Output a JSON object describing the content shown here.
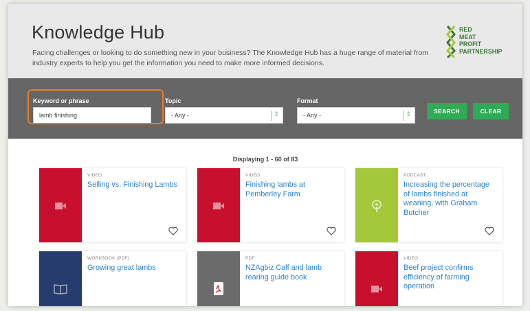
{
  "header": {
    "title": "Knowledge Hub",
    "description": "Facing challenges or looking to do something new in your business? The Knowledge Hub has a huge range of material from industry experts to help you get the information you need to make more informed decisions.",
    "logo": [
      "RED",
      "MEAT",
      "PROFIT",
      "PARTNERSHIP"
    ]
  },
  "filters": {
    "keyword_label": "Keyword or phrase",
    "keyword_value": "lamb finishing",
    "topic_label": "Topic",
    "topic_value": "- Any -",
    "format_label": "Format",
    "format_value": "- Any -",
    "search_label": "SEARCH",
    "clear_label": "CLEAR"
  },
  "results": {
    "summary": "Displaying 1 - 60 of 83",
    "cards": [
      {
        "type": "VIDEO",
        "title": "Selling vs. Finishing Lambs",
        "color": "#c8102e",
        "icon": "video-camera-icon"
      },
      {
        "type": "VIDEO",
        "title": "Finishing lambs at Pemberley Farm",
        "color": "#c8102e",
        "icon": "video-camera-icon"
      },
      {
        "type": "PODCAST",
        "title": "Increasing the percentage of lambs finished at weaning, with Graham Butcher",
        "color": "#a3c93a",
        "icon": "podcast-icon"
      },
      {
        "type": "WORKBOOK (PDF)",
        "title": "Growing great lambs",
        "color": "#263b6e",
        "icon": "book-icon"
      },
      {
        "type": "PDF",
        "title": "NZAgbiz Calf and lamb rearing guide book",
        "color": "#6b6b6b",
        "icon": "pdf-icon"
      },
      {
        "type": "VIDEO",
        "title": "Beef project confirms efficiency of farming operation",
        "color": "#c8102e",
        "icon": "video-camera-icon"
      }
    ]
  }
}
